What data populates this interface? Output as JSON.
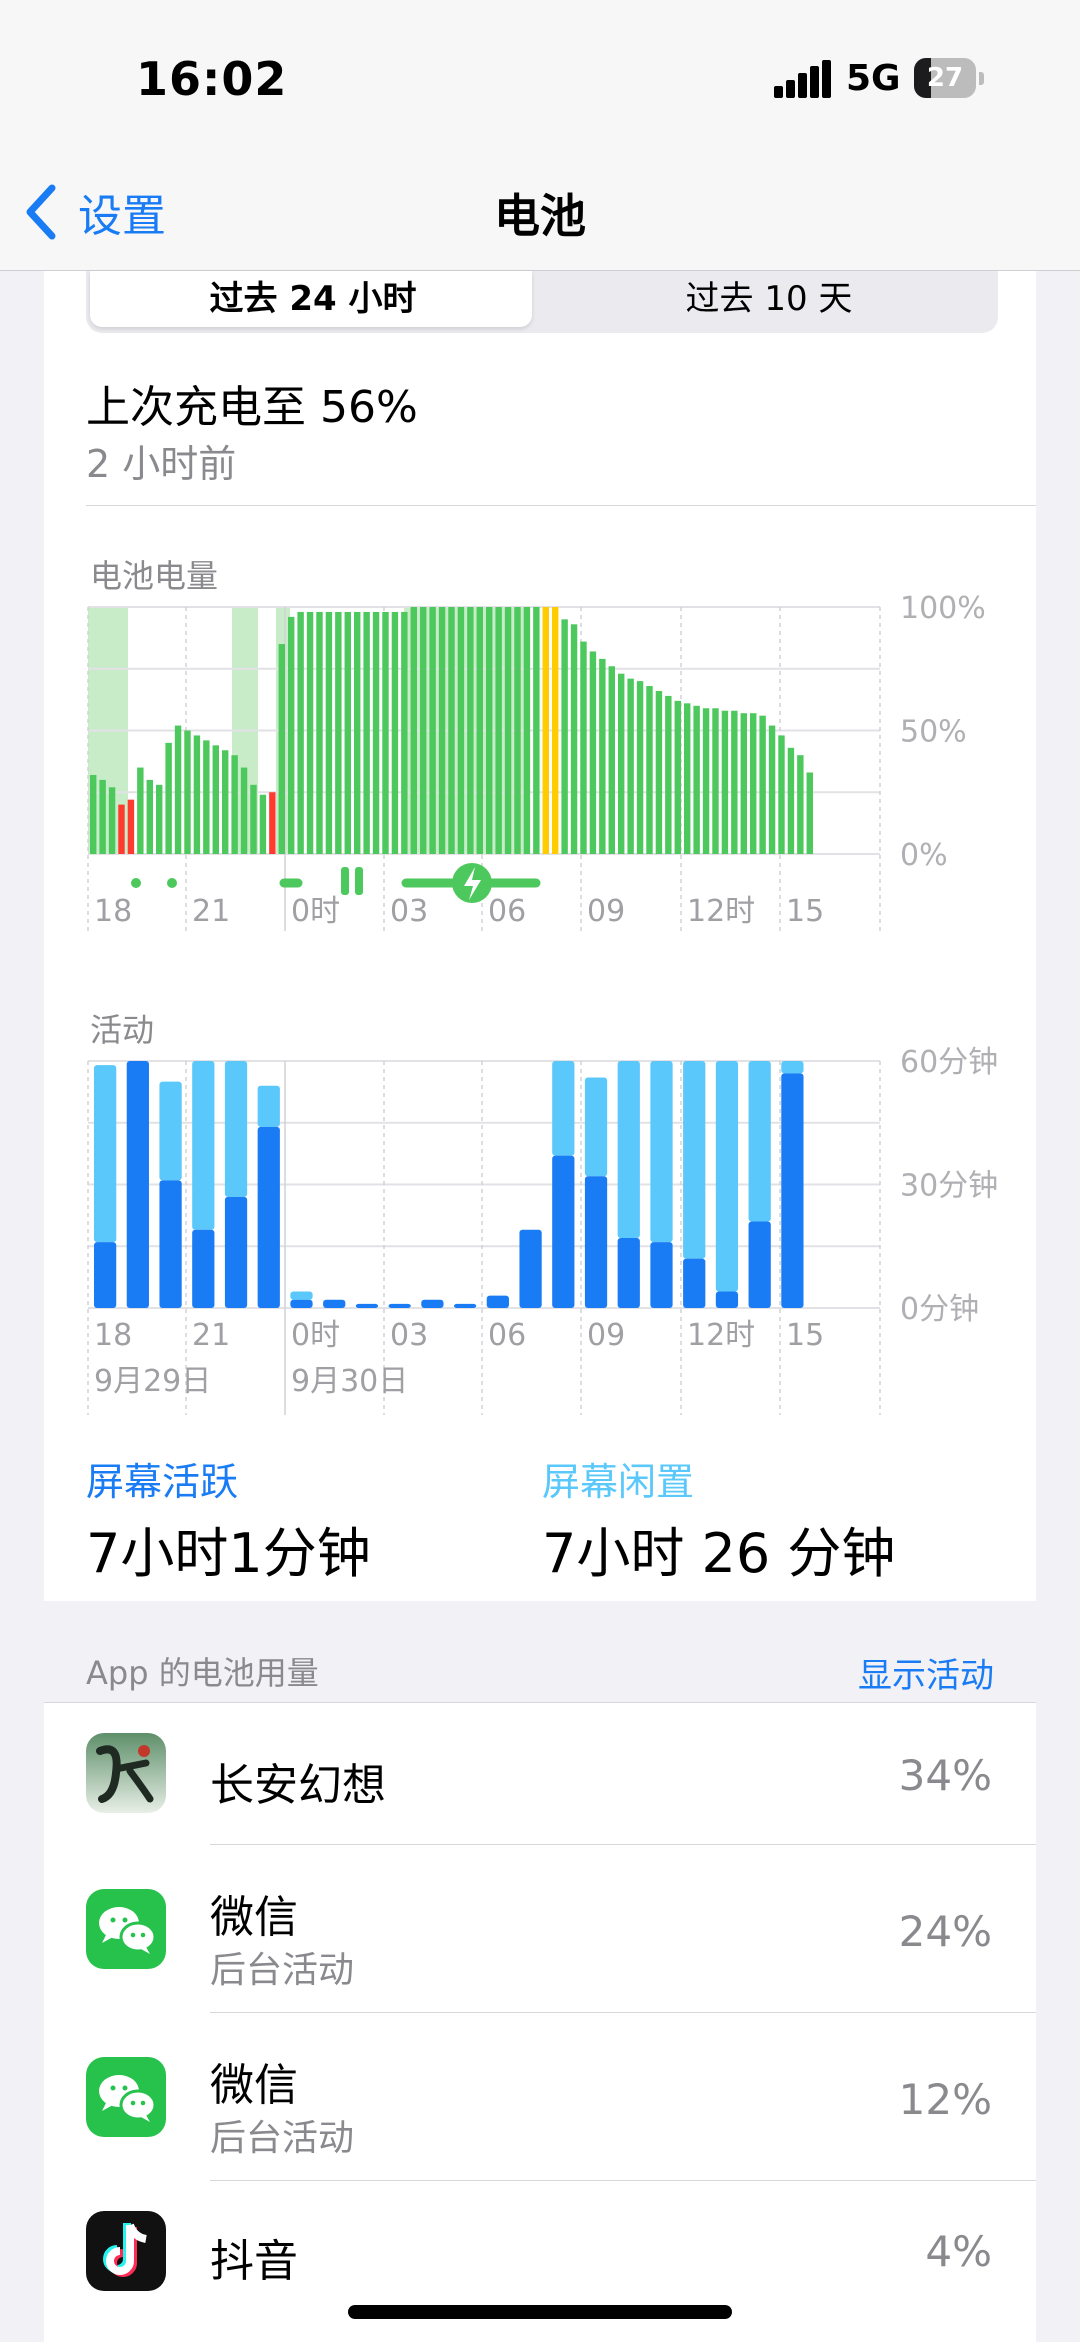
{
  "status": {
    "time": "16:02",
    "network": "5G",
    "battery_level": "27",
    "battery_fraction": 0.27
  },
  "nav": {
    "back_label": "设置",
    "title": "电池"
  },
  "segment": {
    "options": [
      "过去 24 小时",
      "过去 10 天"
    ],
    "selected": "过去 24 小时"
  },
  "last_charge": {
    "title": "上次充电至 56%",
    "time": "2 小时前"
  },
  "battery_chart_label": "电池电量",
  "activity_chart_label": "活动",
  "chart_data": [
    {
      "type": "bar",
      "title": "电池电量",
      "x_ticks": [
        "18",
        "21",
        "0时",
        "03",
        "06",
        "09",
        "12时",
        "15"
      ],
      "y_ticks": [
        "100%",
        "50%",
        "0%"
      ],
      "ylim": [
        0,
        100
      ],
      "values": [
        32,
        30,
        27,
        20,
        22,
        35,
        30,
        28,
        45,
        52,
        50,
        48,
        46,
        44,
        42,
        40,
        35,
        28,
        24,
        25,
        85,
        96,
        98,
        98,
        98,
        98,
        98,
        98,
        98,
        98,
        98,
        98,
        98,
        98,
        100,
        100,
        100,
        100,
        100,
        100,
        100,
        100,
        100,
        100,
        100,
        100,
        100,
        100,
        100,
        100,
        95,
        93,
        86,
        82,
        79,
        76,
        73,
        71,
        70,
        68,
        66,
        64,
        62,
        61,
        60,
        59,
        59,
        58,
        58,
        57,
        57,
        56,
        52,
        48,
        43,
        40,
        33
      ],
      "colors": {
        "normal": "#4cc85c",
        "low": "#ff3b30",
        "mid": "#ffcc00",
        "charging_band": "#c8ecc8"
      },
      "low_indices": [
        3,
        4,
        19
      ],
      "mid_indices": [
        48,
        49
      ]
    },
    {
      "type": "bar",
      "title": "活动",
      "x_ticks": [
        "18",
        "21",
        "0时",
        "03",
        "06",
        "09",
        "12时",
        "15"
      ],
      "date_labels": [
        "9月29日",
        "9月30日"
      ],
      "y_ticks": [
        "60分钟",
        "30分钟",
        "0分钟"
      ],
      "ylim": [
        0,
        60
      ],
      "series": [
        {
          "name": "屏幕活跃",
          "values": [
            16,
            60,
            31,
            19,
            27,
            44,
            2,
            2,
            1,
            1,
            2,
            1,
            3,
            19,
            37,
            32,
            17,
            16,
            12,
            4,
            21,
            57
          ],
          "color": "#1a7cf5"
        },
        {
          "name": "屏幕闲置",
          "values": [
            43,
            0,
            24,
            41,
            33,
            10,
            2,
            0,
            0,
            0,
            0,
            0,
            0,
            0,
            23,
            24,
            43,
            44,
            48,
            56,
            39,
            3
          ],
          "color": "#5ac8fa"
        }
      ]
    }
  ],
  "screen_on": {
    "label": "屏幕活跃",
    "value": "7小时1分钟"
  },
  "screen_idle": {
    "label": "屏幕闲置",
    "value": "7小时 26 分钟"
  },
  "usage": {
    "header": "App 的电池用量",
    "show_activity": "显示活动",
    "apps": [
      {
        "name": "长安幻想",
        "sub": "",
        "percent": "34%",
        "icon": "changan-game-icon"
      },
      {
        "name": "微信",
        "sub": "后台活动",
        "percent": "24%",
        "icon": "wechat-icon"
      },
      {
        "name": "微信",
        "sub": "后台活动",
        "percent": "12%",
        "icon": "wechat-icon"
      },
      {
        "name": "抖音",
        "sub": "",
        "percent": "4%",
        "icon": "douyin-icon"
      }
    ]
  }
}
